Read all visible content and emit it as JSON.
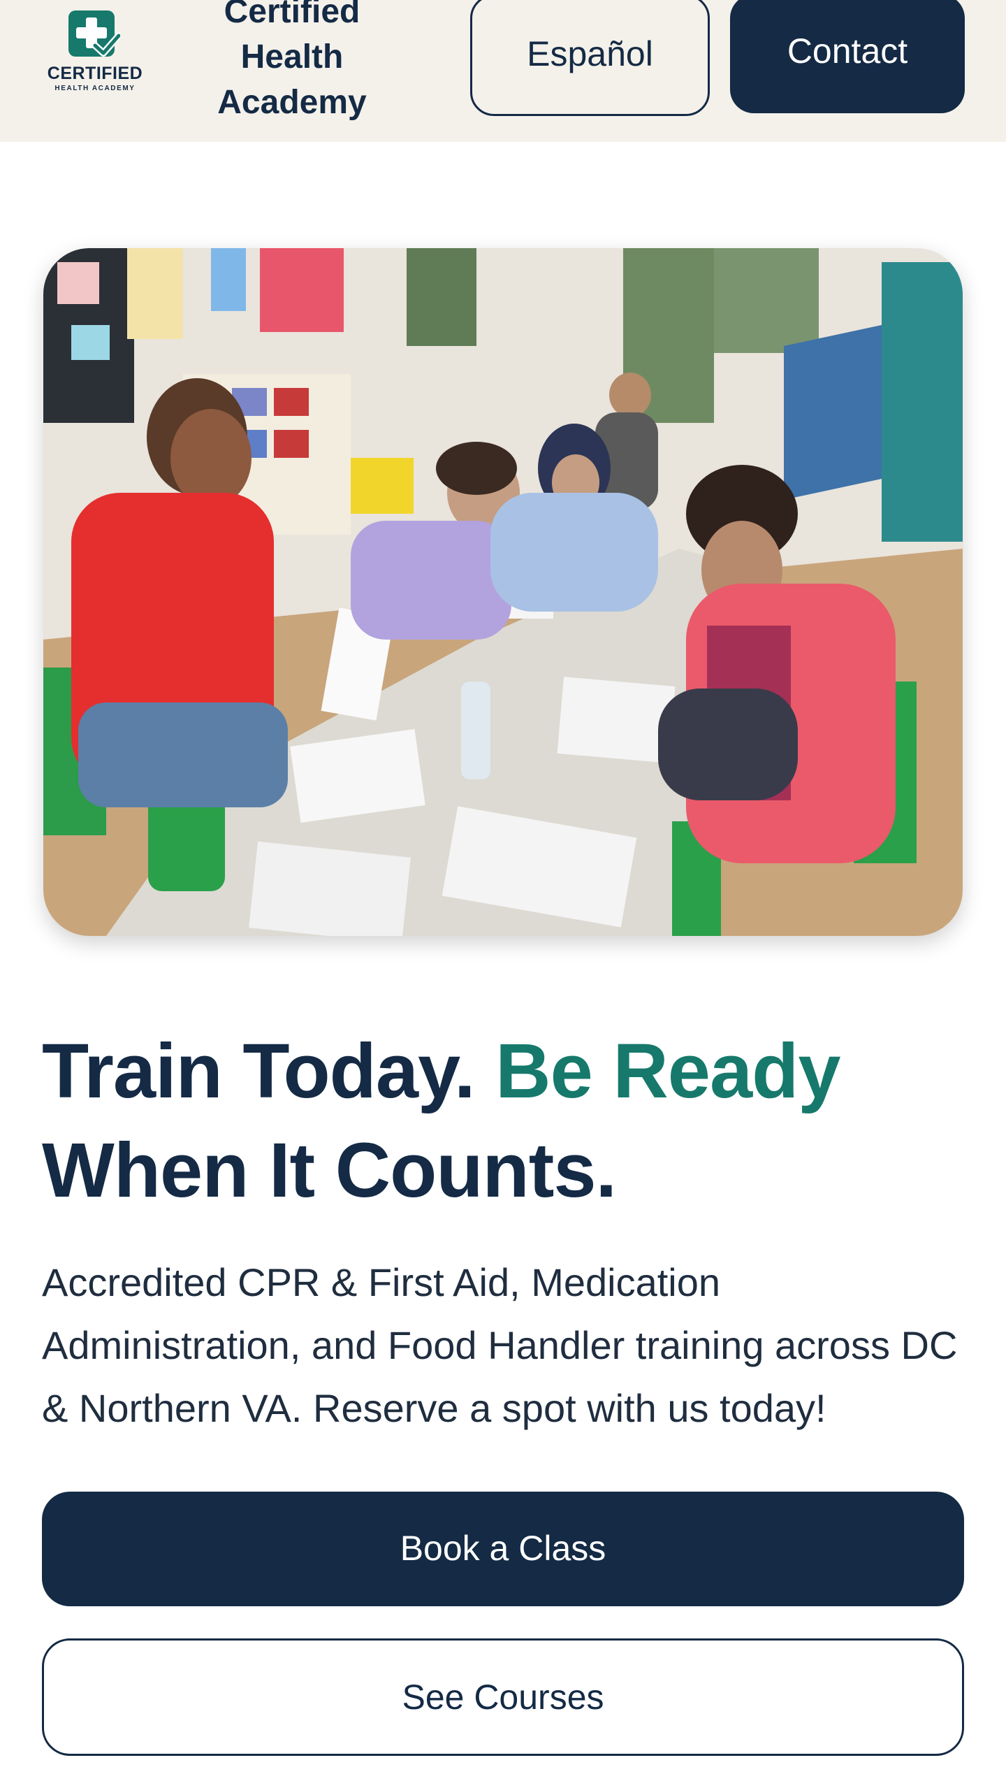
{
  "header": {
    "logo_text": "CERTIFIED",
    "logo_subtext": "HEALTH ACADEMY",
    "brand_lines": [
      "Certified",
      "Health",
      "Academy"
    ],
    "language_button": "Español",
    "contact_button": "Contact"
  },
  "hero": {
    "image_icon": "classroom-photo"
  },
  "headline": {
    "part1": "Train Today.",
    "accent": "Be Ready",
    "part2": "When It Counts."
  },
  "subtext": "Accredited CPR & First Aid, Medication Administration, and Food Handler training across DC & Northern VA. Reserve a spot with us today!",
  "cta": {
    "primary": "Book a Class",
    "secondary": "See Courses"
  },
  "colors": {
    "navy": "#142a45",
    "teal": "#16796b",
    "header_bg": "#f4f1ea"
  }
}
